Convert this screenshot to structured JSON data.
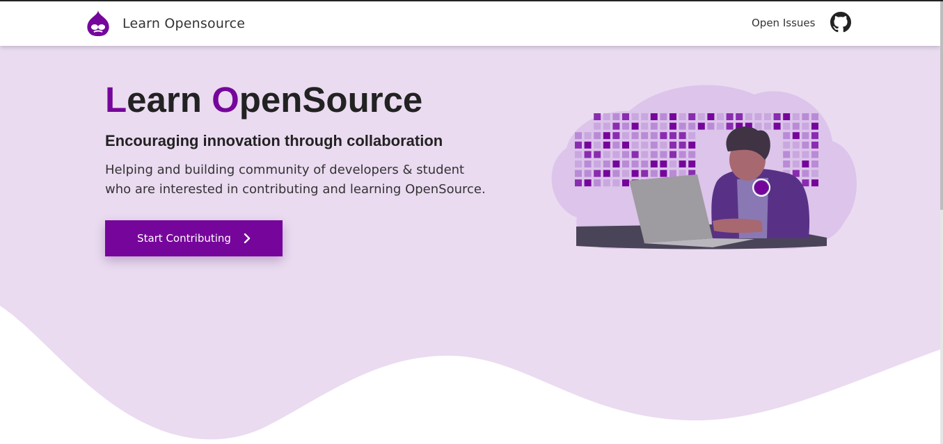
{
  "navbar": {
    "brand_text": "Learn Opensource",
    "links": [
      {
        "label": "Open Issues"
      }
    ],
    "icons": [
      "drupal-drop-logo",
      "github-icon"
    ]
  },
  "hero": {
    "title_first_letter": "L",
    "title_rest_1": "earn ",
    "title_second_letter": "O",
    "title_rest_2": "penSource",
    "subtitle": "Encouraging innovation through collaboration",
    "description_line1": "Helping and building community of developers & student",
    "description_line2": "who are interested in contributing and learning OpenSource.",
    "cta_label": "Start Contributing",
    "cta_icon": "chevron-right-icon"
  },
  "illustration": {
    "name": "developer-at-laptop-illustration"
  },
  "colors": {
    "brand": "#76069b",
    "hero_background": "#eadbf0",
    "cloud": "#dcc4ea",
    "text": "#222222"
  }
}
